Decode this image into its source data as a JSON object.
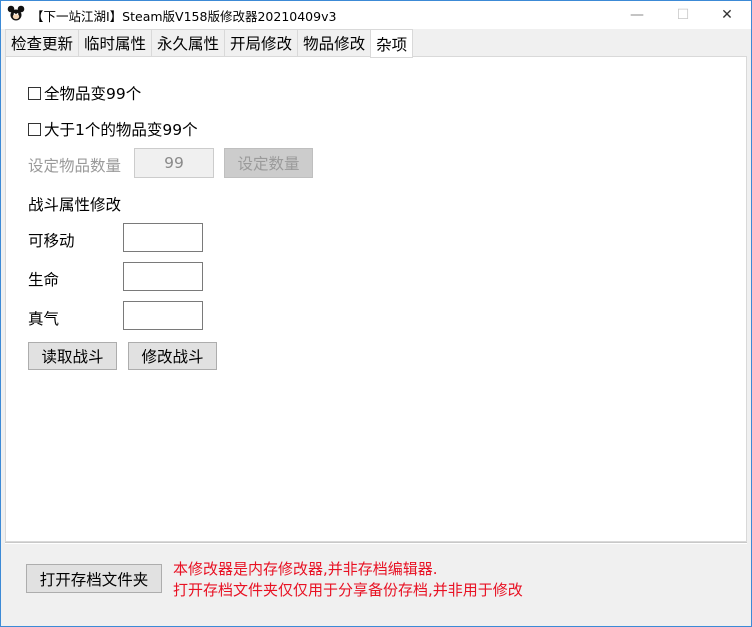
{
  "window": {
    "title": "【下一站江湖Ⅰ】Steam版V158版修改器20210409v3",
    "minimize_glyph": "—",
    "maximize_glyph": "☐",
    "close_glyph": "✕",
    "icon": "app-mouse-icon"
  },
  "tabs": [
    {
      "label": "检查更新",
      "active": false
    },
    {
      "label": "临时属性",
      "active": false
    },
    {
      "label": "永久属性",
      "active": false
    },
    {
      "label": "开局修改",
      "active": false
    },
    {
      "label": "物品修改",
      "active": false
    },
    {
      "label": "杂项",
      "active": true
    }
  ],
  "misc": {
    "checkbox_all_items": {
      "label": "全物品变99个",
      "checked": false
    },
    "checkbox_over_one": {
      "label": "大于1个的物品变99个",
      "checked": false
    },
    "set_quantity_label": "设定物品数量",
    "set_quantity_value": "99",
    "set_quantity_button": "设定数量",
    "battle_section_title": "战斗属性修改",
    "fields": [
      {
        "label": "可移动",
        "value": ""
      },
      {
        "label": "生命",
        "value": ""
      },
      {
        "label": "真气",
        "value": ""
      }
    ],
    "read_battle_button": "读取战斗",
    "modify_battle_button": "修改战斗"
  },
  "footer": {
    "open_save_folder_button": "打开存档文件夹",
    "note_line1": "本修改器是内存修改器,并非存档编辑器.",
    "note_line2": "打开存档文件夹仅仅用于分享备份存档,并非用于修改"
  },
  "colors": {
    "accent_border": "#3c8ad6",
    "note_red": "#e81123",
    "window_bg": "#f0f0f0"
  }
}
